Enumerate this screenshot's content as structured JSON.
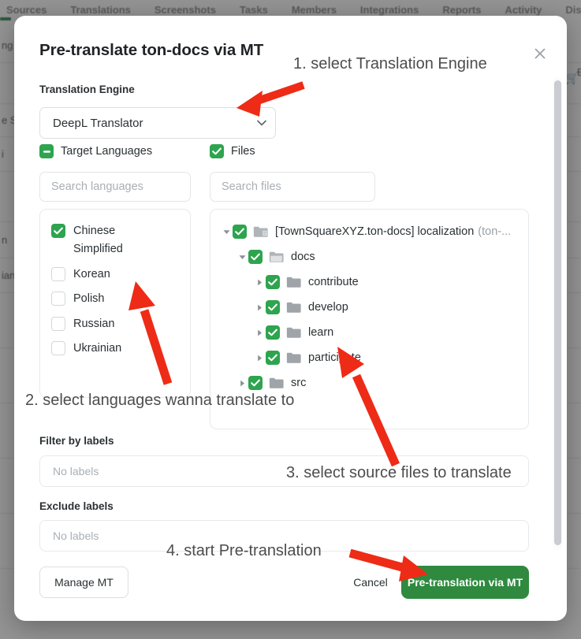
{
  "background": {
    "nav_items": [
      "Sources",
      "Translations",
      "Screenshots",
      "Tasks",
      "Members",
      "Integrations",
      "Reports",
      "Activity",
      "Dis"
    ],
    "row_fragments": [
      "ng",
      "e S",
      "i",
      "n",
      "ian"
    ],
    "cart_icon": "cart-icon",
    "fragment_right": "E"
  },
  "modal": {
    "title": "Pre-translate ton-docs via MT",
    "close_icon": "close-icon",
    "engine": {
      "label": "Translation Engine",
      "selected": "DeepL Translator",
      "options": [
        "DeepL Translator"
      ],
      "caret_icon": "chevron-down-icon"
    },
    "target_languages": {
      "label": "Target Languages",
      "checkbox_state": "indeterminate",
      "search_placeholder": "Search languages",
      "items": [
        {
          "label": "Chinese Simplified",
          "checked": true
        },
        {
          "label": "Korean",
          "checked": false
        },
        {
          "label": "Polish",
          "checked": false
        },
        {
          "label": "Russian",
          "checked": false
        },
        {
          "label": "Ukrainian",
          "checked": false
        }
      ]
    },
    "files": {
      "label": "Files",
      "checkbox_state": "checked",
      "search_placeholder": "Search files",
      "tree": [
        {
          "label": "[TownSquareXYZ.ton-docs] localization",
          "suffix": "(ton-...",
          "checked": true,
          "expanded": true,
          "depth": 0,
          "icon": "folder-repo-icon"
        },
        {
          "label": "docs",
          "suffix": "",
          "checked": true,
          "expanded": true,
          "depth": 1,
          "icon": "folder-open-icon"
        },
        {
          "label": "contribute",
          "suffix": "",
          "checked": true,
          "expanded": false,
          "depth": 2,
          "icon": "folder-icon"
        },
        {
          "label": "develop",
          "suffix": "",
          "checked": true,
          "expanded": false,
          "depth": 2,
          "icon": "folder-icon"
        },
        {
          "label": "learn",
          "suffix": "",
          "checked": true,
          "expanded": false,
          "depth": 2,
          "icon": "folder-icon"
        },
        {
          "label": "participate",
          "suffix": "",
          "checked": true,
          "expanded": false,
          "depth": 2,
          "icon": "folder-icon"
        },
        {
          "label": "src",
          "suffix": "",
          "checked": true,
          "expanded": false,
          "depth": 1,
          "icon": "folder-icon"
        }
      ]
    },
    "filter_labels": {
      "label": "Filter by labels",
      "value": "No labels"
    },
    "exclude_labels": {
      "label": "Exclude labels",
      "value": "No labels"
    },
    "footer": {
      "manage_mt": "Manage MT",
      "cancel": "Cancel",
      "submit": "Pre-translation via MT"
    }
  },
  "annotations": {
    "step1": "1. select Translation Engine",
    "step2": "2. select languages wanna translate to",
    "step3": "3. select source files to translate",
    "step4": "4. start Pre-translation",
    "arrow_color": "#ee2b16"
  }
}
